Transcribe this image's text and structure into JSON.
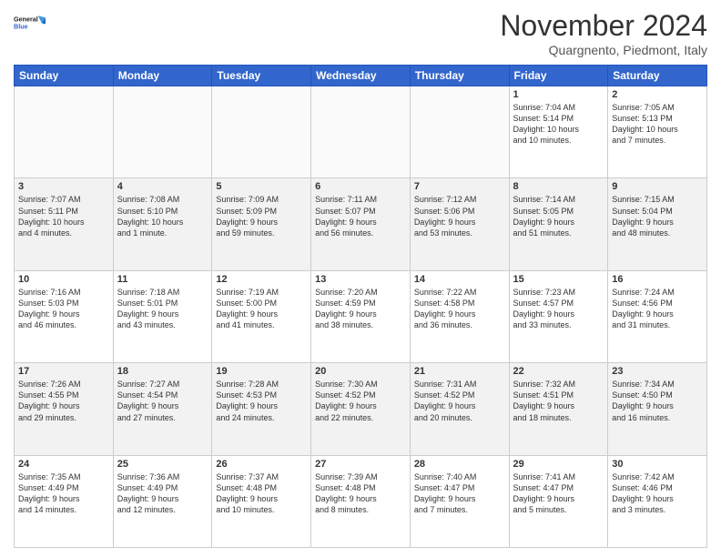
{
  "header": {
    "logo_line1": "General",
    "logo_line2": "Blue",
    "month_title": "November 2024",
    "location": "Quargnento, Piedmont, Italy"
  },
  "weekdays": [
    "Sunday",
    "Monday",
    "Tuesday",
    "Wednesday",
    "Thursday",
    "Friday",
    "Saturday"
  ],
  "weeks": [
    [
      {
        "day": "",
        "info": ""
      },
      {
        "day": "",
        "info": ""
      },
      {
        "day": "",
        "info": ""
      },
      {
        "day": "",
        "info": ""
      },
      {
        "day": "",
        "info": ""
      },
      {
        "day": "1",
        "info": "Sunrise: 7:04 AM\nSunset: 5:14 PM\nDaylight: 10 hours\nand 10 minutes."
      },
      {
        "day": "2",
        "info": "Sunrise: 7:05 AM\nSunset: 5:13 PM\nDaylight: 10 hours\nand 7 minutes."
      }
    ],
    [
      {
        "day": "3",
        "info": "Sunrise: 7:07 AM\nSunset: 5:11 PM\nDaylight: 10 hours\nand 4 minutes."
      },
      {
        "day": "4",
        "info": "Sunrise: 7:08 AM\nSunset: 5:10 PM\nDaylight: 10 hours\nand 1 minute."
      },
      {
        "day": "5",
        "info": "Sunrise: 7:09 AM\nSunset: 5:09 PM\nDaylight: 9 hours\nand 59 minutes."
      },
      {
        "day": "6",
        "info": "Sunrise: 7:11 AM\nSunset: 5:07 PM\nDaylight: 9 hours\nand 56 minutes."
      },
      {
        "day": "7",
        "info": "Sunrise: 7:12 AM\nSunset: 5:06 PM\nDaylight: 9 hours\nand 53 minutes."
      },
      {
        "day": "8",
        "info": "Sunrise: 7:14 AM\nSunset: 5:05 PM\nDaylight: 9 hours\nand 51 minutes."
      },
      {
        "day": "9",
        "info": "Sunrise: 7:15 AM\nSunset: 5:04 PM\nDaylight: 9 hours\nand 48 minutes."
      }
    ],
    [
      {
        "day": "10",
        "info": "Sunrise: 7:16 AM\nSunset: 5:03 PM\nDaylight: 9 hours\nand 46 minutes."
      },
      {
        "day": "11",
        "info": "Sunrise: 7:18 AM\nSunset: 5:01 PM\nDaylight: 9 hours\nand 43 minutes."
      },
      {
        "day": "12",
        "info": "Sunrise: 7:19 AM\nSunset: 5:00 PM\nDaylight: 9 hours\nand 41 minutes."
      },
      {
        "day": "13",
        "info": "Sunrise: 7:20 AM\nSunset: 4:59 PM\nDaylight: 9 hours\nand 38 minutes."
      },
      {
        "day": "14",
        "info": "Sunrise: 7:22 AM\nSunset: 4:58 PM\nDaylight: 9 hours\nand 36 minutes."
      },
      {
        "day": "15",
        "info": "Sunrise: 7:23 AM\nSunset: 4:57 PM\nDaylight: 9 hours\nand 33 minutes."
      },
      {
        "day": "16",
        "info": "Sunrise: 7:24 AM\nSunset: 4:56 PM\nDaylight: 9 hours\nand 31 minutes."
      }
    ],
    [
      {
        "day": "17",
        "info": "Sunrise: 7:26 AM\nSunset: 4:55 PM\nDaylight: 9 hours\nand 29 minutes."
      },
      {
        "day": "18",
        "info": "Sunrise: 7:27 AM\nSunset: 4:54 PM\nDaylight: 9 hours\nand 27 minutes."
      },
      {
        "day": "19",
        "info": "Sunrise: 7:28 AM\nSunset: 4:53 PM\nDaylight: 9 hours\nand 24 minutes."
      },
      {
        "day": "20",
        "info": "Sunrise: 7:30 AM\nSunset: 4:52 PM\nDaylight: 9 hours\nand 22 minutes."
      },
      {
        "day": "21",
        "info": "Sunrise: 7:31 AM\nSunset: 4:52 PM\nDaylight: 9 hours\nand 20 minutes."
      },
      {
        "day": "22",
        "info": "Sunrise: 7:32 AM\nSunset: 4:51 PM\nDaylight: 9 hours\nand 18 minutes."
      },
      {
        "day": "23",
        "info": "Sunrise: 7:34 AM\nSunset: 4:50 PM\nDaylight: 9 hours\nand 16 minutes."
      }
    ],
    [
      {
        "day": "24",
        "info": "Sunrise: 7:35 AM\nSunset: 4:49 PM\nDaylight: 9 hours\nand 14 minutes."
      },
      {
        "day": "25",
        "info": "Sunrise: 7:36 AM\nSunset: 4:49 PM\nDaylight: 9 hours\nand 12 minutes."
      },
      {
        "day": "26",
        "info": "Sunrise: 7:37 AM\nSunset: 4:48 PM\nDaylight: 9 hours\nand 10 minutes."
      },
      {
        "day": "27",
        "info": "Sunrise: 7:39 AM\nSunset: 4:48 PM\nDaylight: 9 hours\nand 8 minutes."
      },
      {
        "day": "28",
        "info": "Sunrise: 7:40 AM\nSunset: 4:47 PM\nDaylight: 9 hours\nand 7 minutes."
      },
      {
        "day": "29",
        "info": "Sunrise: 7:41 AM\nSunset: 4:47 PM\nDaylight: 9 hours\nand 5 minutes."
      },
      {
        "day": "30",
        "info": "Sunrise: 7:42 AM\nSunset: 4:46 PM\nDaylight: 9 hours\nand 3 minutes."
      }
    ]
  ]
}
